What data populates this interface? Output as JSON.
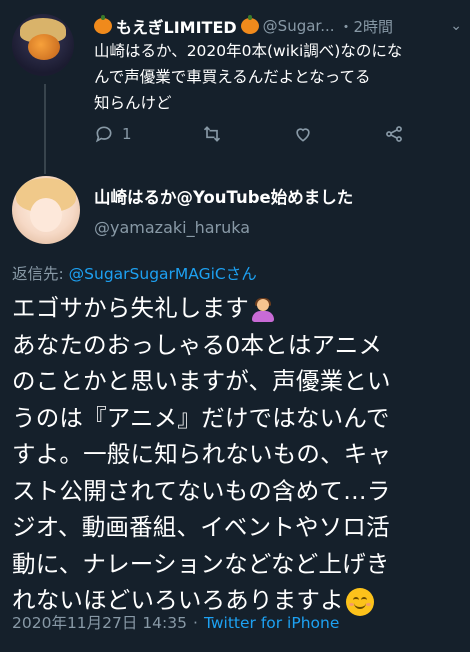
{
  "tweet1": {
    "display_name": "もえぎLIMITED",
    "handle": "@Sugar...",
    "time": "・2時間",
    "text_lines": [
      "山崎はるか、2020年0本(wiki調べ)なのにな",
      "んで声優業で車買えるんだよとなってる",
      "知らんけど"
    ],
    "reply_count": "1",
    "icons": [
      "reply-icon",
      "retweet-icon",
      "like-icon",
      "share-icon"
    ]
  },
  "tweet2": {
    "display_name": "山崎はるか@YouTube始めました",
    "handle": "@yamazaki_haruka",
    "reply_prefix": "返信先: ",
    "reply_to": "@SugarSugarMAGiCさん",
    "text_lines": [
      "エゴサから失礼します",
      "あなたのおっしゃる0本とはアニメ",
      "のことかと思いますが、声優業とい",
      "うのは『アニメ』だけではないんで",
      "すよ。一般に知られないもの、キャ",
      "スト公開されてないもの含めて…ラ",
      "ジオ、動画番組、イベントやソロ活",
      "動に、ナレーションなどなど上げき",
      "れないほどいろいろありますよ"
    ],
    "timestamp": "2020年11月27日 14:35",
    "separator": "·",
    "source": "Twitter for iPhone"
  },
  "colors": {
    "background": "#15202b",
    "secondary_text": "#8899a6",
    "link": "#1da1f2",
    "thread_line": "#38444d"
  }
}
